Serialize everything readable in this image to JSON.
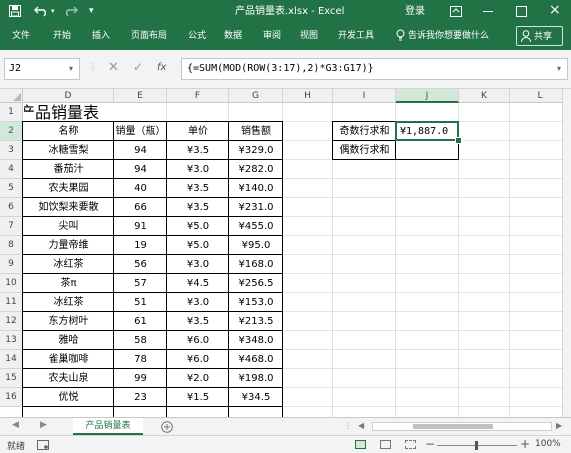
{
  "window": {
    "title": "产品销量表.xlsx  -  Excel",
    "login": "登录",
    "save_icon": "save-icon",
    "brand_color": "#217346"
  },
  "ribbon": {
    "tabs": [
      "文件",
      "开始",
      "插入",
      "页面布局",
      "公式",
      "数据",
      "审阅",
      "视图",
      "开发工具"
    ],
    "tell_me": "告诉我你想要做什么",
    "share": "共享"
  },
  "formula_bar": {
    "name_box": "J2",
    "fx": "fx",
    "formula": "{=SUM(MOD(ROW(3:17),2)*G3:G17)}"
  },
  "sheet": {
    "columns": [
      "D",
      "E",
      "F",
      "G",
      "H",
      "I",
      "J",
      "K",
      "L"
    ],
    "selected_column": "J",
    "rows": [
      "1",
      "2",
      "3",
      "4",
      "5",
      "6",
      "7",
      "8",
      "9",
      "10",
      "11",
      "12",
      "13",
      "14",
      "15",
      "16"
    ],
    "selected_row": "2",
    "title": "产品销量表",
    "headers": [
      "名称",
      "销量（瓶）",
      "单价",
      "销售额"
    ],
    "data": [
      [
        "冰糖雪梨",
        "94",
        "¥3.5",
        "¥329.0"
      ],
      [
        "番茄汁",
        "94",
        "¥3.0",
        "¥282.0"
      ],
      [
        "农夫果园",
        "40",
        "¥3.5",
        "¥140.0"
      ],
      [
        "如饮梨来要散",
        "66",
        "¥3.5",
        "¥231.0"
      ],
      [
        "尖叫",
        "91",
        "¥5.0",
        "¥455.0"
      ],
      [
        "力量帝维",
        "19",
        "¥5.0",
        "¥95.0"
      ],
      [
        "冰红茶",
        "56",
        "¥3.0",
        "¥168.0"
      ],
      [
        "茶π",
        "57",
        "¥4.5",
        "¥256.5"
      ],
      [
        "冰红茶",
        "51",
        "¥3.0",
        "¥153.0"
      ],
      [
        "东方树叶",
        "61",
        "¥3.5",
        "¥213.5"
      ],
      [
        "雅哈",
        "58",
        "¥6.0",
        "¥348.0"
      ],
      [
        "雀巢咖啡",
        "78",
        "¥6.0",
        "¥468.0"
      ],
      [
        "农夫山泉",
        "99",
        "¥2.0",
        "¥198.0"
      ],
      [
        "优悦",
        "23",
        "¥1.5",
        "¥34.5"
      ]
    ],
    "summary": {
      "odd_label": "奇数行求和",
      "odd_value": "¥1,887.0",
      "even_label": "偶数行求和",
      "even_value": ""
    }
  },
  "sheet_tabs": {
    "active": "产品销量表"
  },
  "status": {
    "ready": "就绪",
    "zoom": "100%"
  }
}
